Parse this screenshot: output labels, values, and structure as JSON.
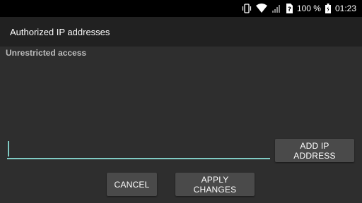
{
  "status_bar": {
    "battery_percent": "100 %",
    "time": "01:23",
    "icons": [
      "vibrate-icon",
      "wifi-icon",
      "signal-icon",
      "no-sim-icon",
      "battery-icon"
    ]
  },
  "app_bar": {
    "title": "Authorized IP addresses"
  },
  "content": {
    "status_label": "Unrestricted access",
    "ip_input": {
      "value": "",
      "placeholder": ""
    },
    "add_button_label": "ADD IP ADDRESS",
    "cancel_button_label": "CANCEL",
    "apply_button_label": "APPLY CHANGES"
  },
  "colors": {
    "accent": "#80cbc4",
    "background": "#2e2e2e",
    "app_bar": "#212121",
    "button": "#4a4a4a"
  }
}
